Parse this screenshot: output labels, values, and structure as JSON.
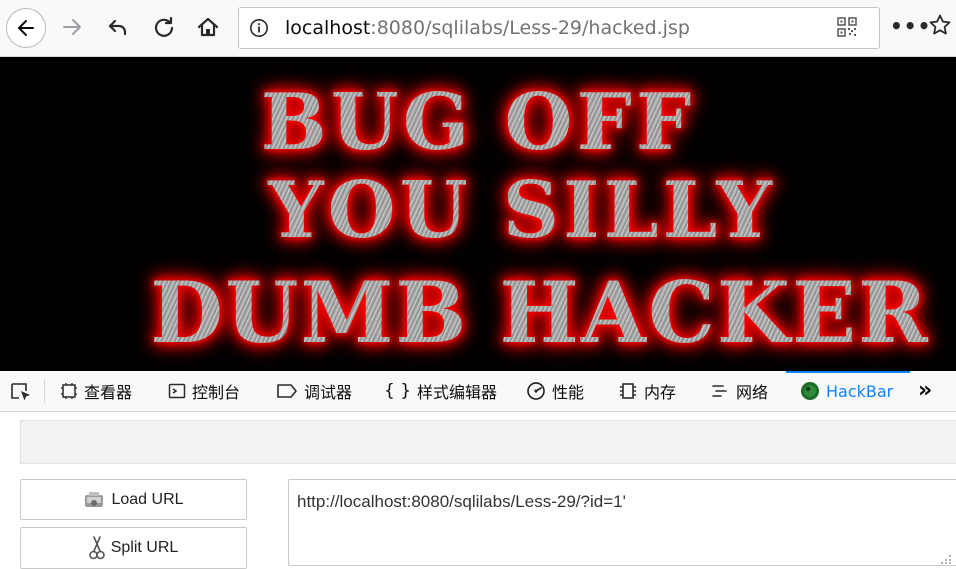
{
  "toolbar": {
    "back": "back-arrow",
    "forward": "forward-arrow",
    "undo": "undo-arrow",
    "reload": "reload",
    "home": "home",
    "url_host": "localhost",
    "url_rest": ":8080/sqlilabs/Less-29/hacked.jsp",
    "more": "•••"
  },
  "banner": {
    "lines": [
      "BUG OFF",
      "YOU SILLY",
      "DUMB HACKER"
    ],
    "text_color": "#b9b9b9",
    "glow_color": "#ff0000"
  },
  "devtools": {
    "tabs": [
      {
        "label": "查看器",
        "icon": "inspector-icon"
      },
      {
        "label": "控制台",
        "icon": "console-icon"
      },
      {
        "label": "调试器",
        "icon": "debugger-icon"
      },
      {
        "label": "样式编辑器",
        "icon": "style-editor-icon"
      },
      {
        "label": "性能",
        "icon": "performance-icon"
      },
      {
        "label": "内存",
        "icon": "memory-icon"
      },
      {
        "label": "网络",
        "icon": "network-icon"
      },
      {
        "label": "HackBar",
        "icon": "hackbar-icon"
      }
    ],
    "active_tab": "HackBar",
    "active_color": "#0a84ff",
    "overflow": "»"
  },
  "hackbar": {
    "load_url_label": "Load URL",
    "split_url_label": "Split URL",
    "url_value": "http://localhost:8080/sqlilabs/Less-29/?id=1'"
  }
}
